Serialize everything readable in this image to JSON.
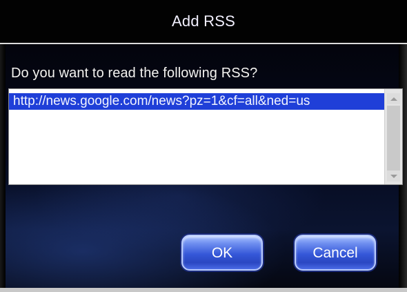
{
  "dialog": {
    "title": "Add RSS",
    "prompt": "Do you want to read the following RSS?",
    "rss_items": [
      "http://news.google.com/news?pz=1&cf=all&ned=us"
    ],
    "buttons": {
      "ok_label": "OK",
      "cancel_label": "Cancel"
    }
  },
  "colors": {
    "selection": "#1f3fd8",
    "button": "#3557d8",
    "title_bg": "#020202"
  }
}
